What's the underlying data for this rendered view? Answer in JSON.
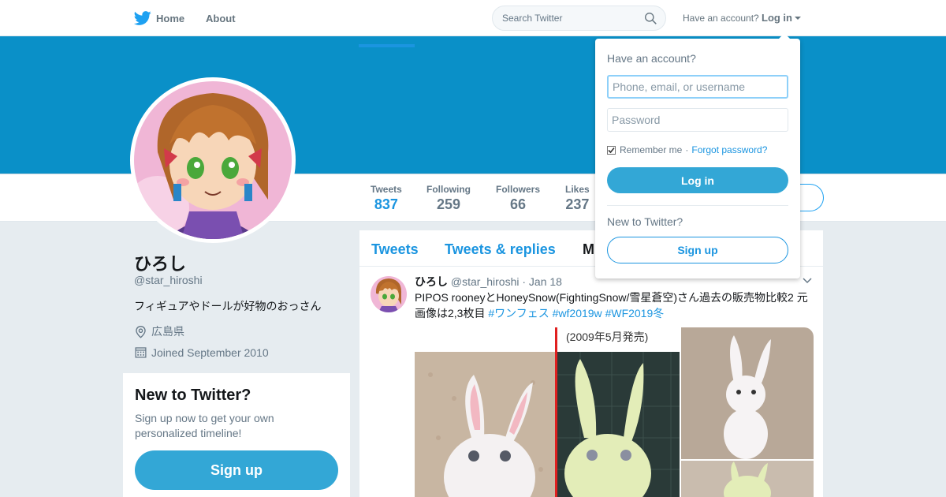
{
  "nav": {
    "home_label": "Home",
    "about_label": "About",
    "search_placeholder": "Search Twitter",
    "have_account": "Have an account?",
    "login_label": "Log in"
  },
  "profile": {
    "name": "ひろし",
    "handle": "@star_hiroshi",
    "bio": "フィギュアやドールが好物のおっさん",
    "location": "広島県",
    "joined": "Joined September 2010"
  },
  "stats": [
    {
      "label": "Tweets",
      "value": "837"
    },
    {
      "label": "Following",
      "value": "259"
    },
    {
      "label": "Followers",
      "value": "66"
    },
    {
      "label": "Likes",
      "value": "237"
    }
  ],
  "signup_card": {
    "title": "New to Twitter?",
    "text": "Sign up now to get your own personalized timeline!",
    "button": "Sign up"
  },
  "timeline": {
    "tabs": [
      "Tweets",
      "Tweets & replies",
      "M"
    ]
  },
  "tweet": {
    "name": "ひろし",
    "handle": "@star_hiroshi",
    "separator": "·",
    "date": "Jan 18",
    "text": "PIPOS rooneyとHoneySnow(FightingSnow/雪星蒼空)さん過去の販売物比較2 元画像は2,3枚目",
    "hashtags": [
      "#ワンフェス",
      "#wf2019w",
      "#WF2019冬"
    ],
    "media_caption": "(2009年5月発売)"
  },
  "login_dropdown": {
    "heading": "Have an account?",
    "username_placeholder": "Phone, email, or username",
    "password_placeholder": "Password",
    "remember_label": "Remember me",
    "separator": "·",
    "forgot_label": "Forgot password?",
    "login_button": "Log in",
    "new_label": "New to Twitter?",
    "signup_button": "Sign up"
  },
  "colors": {
    "banner": "#0a90c8",
    "accent": "#1b95e0",
    "button_fill": "#33a7d6"
  }
}
